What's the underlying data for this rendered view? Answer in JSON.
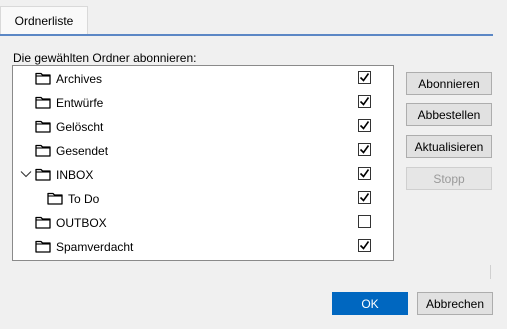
{
  "tabs": [
    {
      "label": "Ordnerliste",
      "active": true
    }
  ],
  "list_caption": "Die gewählten Ordner abonnieren:",
  "folders": [
    {
      "name": "Archives",
      "subscribed": true,
      "level": 0,
      "expanded": null
    },
    {
      "name": "Entwürfe",
      "subscribed": true,
      "level": 0,
      "expanded": null
    },
    {
      "name": "Gelöscht",
      "subscribed": true,
      "level": 0,
      "expanded": null
    },
    {
      "name": "Gesendet",
      "subscribed": true,
      "level": 0,
      "expanded": null
    },
    {
      "name": "INBOX",
      "subscribed": true,
      "level": 0,
      "expanded": true
    },
    {
      "name": "To Do",
      "subscribed": true,
      "level": 1,
      "expanded": null
    },
    {
      "name": "OUTBOX",
      "subscribed": false,
      "level": 0,
      "expanded": null
    },
    {
      "name": "Spamverdacht",
      "subscribed": true,
      "level": 0,
      "expanded": null
    }
  ],
  "side_buttons": {
    "subscribe": "Abonnieren",
    "unsubscribe": "Abbestellen",
    "refresh": "Aktualisieren",
    "stop": "Stopp"
  },
  "footer": {
    "ok": "OK",
    "cancel": "Abbrechen"
  },
  "colors": {
    "accent": "#0067c0",
    "tab_underline": "#5b87c5"
  }
}
